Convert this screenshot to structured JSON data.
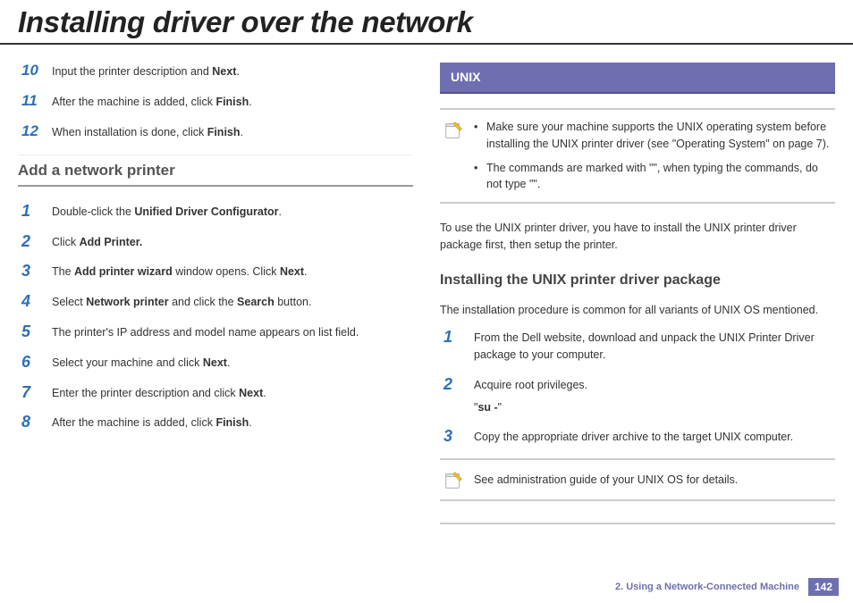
{
  "page": {
    "title": "Installing driver over the network"
  },
  "left": {
    "cont_steps": [
      {
        "num": "10",
        "parts": [
          "Input the printer description and ",
          {
            "b": "Next"
          },
          "."
        ]
      },
      {
        "num": "11",
        "parts": [
          "After the machine is added, click ",
          {
            "b": "Finish"
          },
          "."
        ]
      },
      {
        "num": "12",
        "parts": [
          "When installation is done, click ",
          {
            "b": "Finish"
          },
          "."
        ]
      }
    ],
    "section_title": "Add a network printer",
    "steps": [
      {
        "num": "1",
        "parts": [
          "Double-click the ",
          {
            "b": "Unified Driver Configurator"
          },
          "."
        ]
      },
      {
        "num": "2",
        "parts": [
          "Click ",
          {
            "b": "Add Printer."
          }
        ]
      },
      {
        "num": "3",
        "parts": [
          "The ",
          {
            "b": "Add printer wizard"
          },
          " window opens. Click ",
          {
            "b": "Next"
          },
          "."
        ]
      },
      {
        "num": "4",
        "parts": [
          "Select ",
          {
            "b": "Network printer"
          },
          " and click the ",
          {
            "b": "Search"
          },
          " button."
        ]
      },
      {
        "num": "5",
        "parts": [
          "The printer's IP address and model name appears on list field."
        ]
      },
      {
        "num": "6",
        "parts": [
          "Select your machine and click ",
          {
            "b": "Next"
          },
          "."
        ]
      },
      {
        "num": "7",
        "parts": [
          "Enter the printer description and click ",
          {
            "b": "Next"
          },
          "."
        ]
      },
      {
        "num": "8",
        "parts": [
          "After the machine is added, click ",
          {
            "b": "Finish"
          },
          "."
        ]
      }
    ]
  },
  "right": {
    "banner": "UNIX",
    "note1": [
      "Make sure your machine supports the UNIX operating system before installing the UNIX printer driver (see \"Operating System\" on page 7).",
      "The commands are marked with \"\", when typing the commands, do not type \"\"."
    ],
    "intro": "To use the UNIX printer driver, you have to install the UNIX printer driver package first, then setup the printer.",
    "section_title": "Installing the UNIX printer driver package",
    "subintro": "The installation procedure is common for all variants of UNIX OS mentioned.",
    "steps": [
      {
        "num": "1",
        "parts": [
          "From the Dell website, download and unpack the UNIX Printer Driver package to your computer."
        ]
      },
      {
        "num": "2",
        "parts": [
          "Acquire root privileges."
        ],
        "extra": [
          "\"",
          {
            "b": "su -"
          },
          "\""
        ]
      },
      {
        "num": "3",
        "parts": [
          "Copy the appropriate driver archive to the target UNIX computer."
        ]
      }
    ],
    "note2": "See administration guide of your UNIX OS for details."
  },
  "footer": {
    "text": "2.  Using a Network-Connected Machine",
    "page": "142"
  }
}
